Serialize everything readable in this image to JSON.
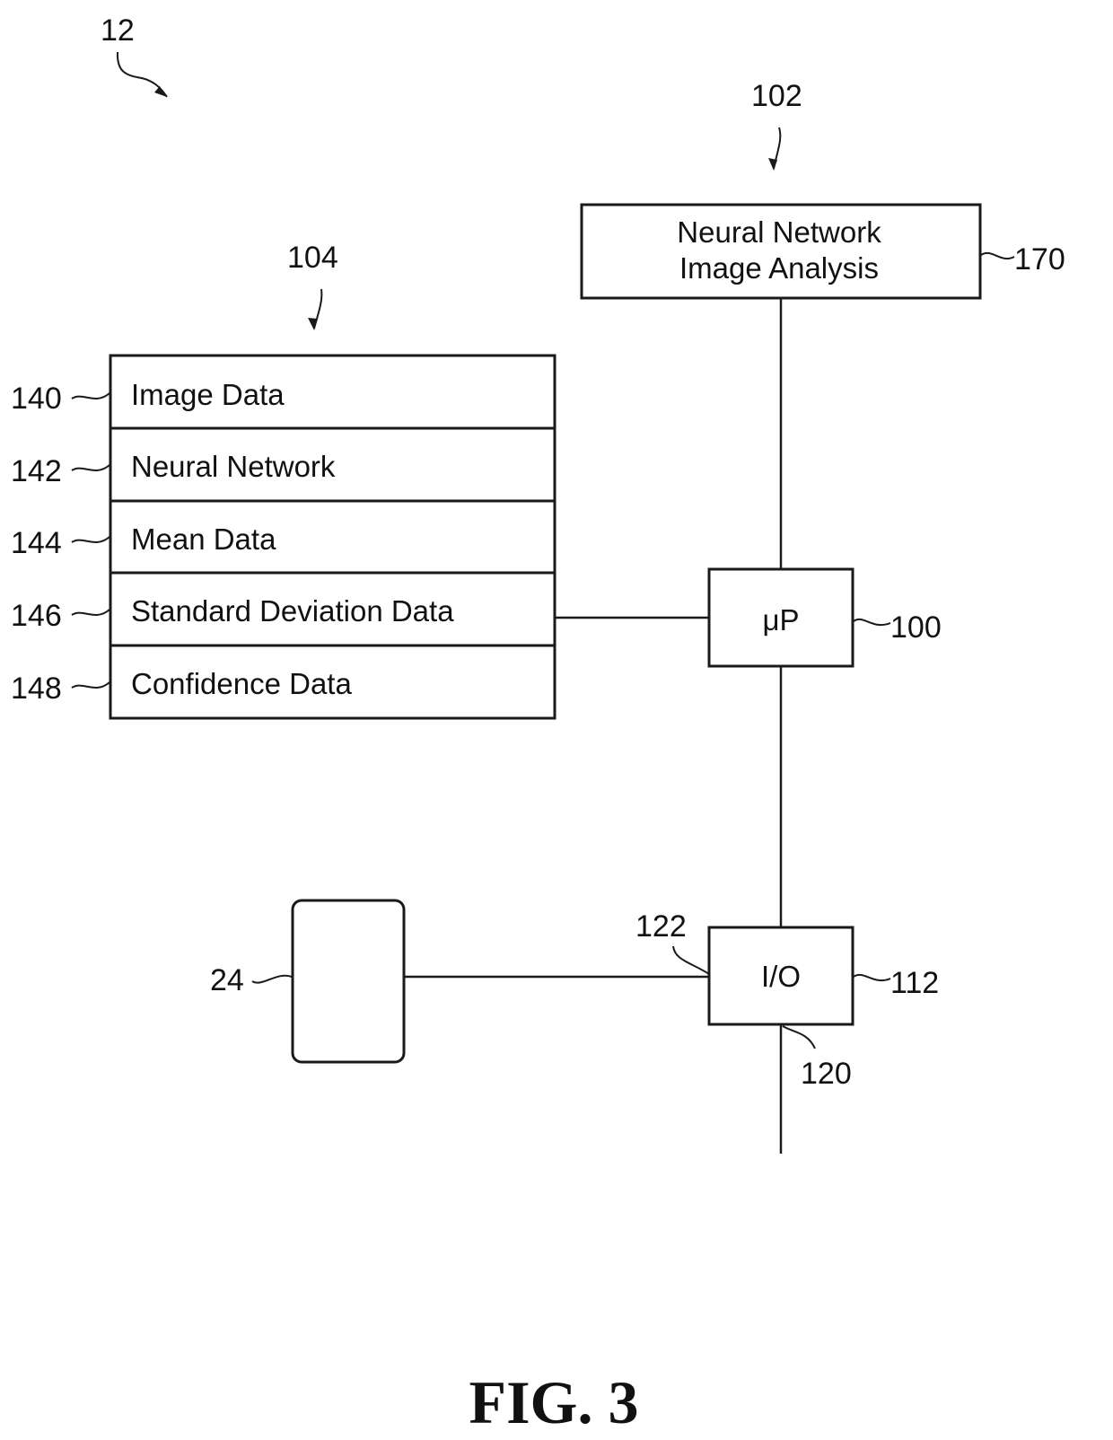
{
  "figure": {
    "caption": "FIG. 3",
    "system_ref": "12"
  },
  "nn_module": {
    "ref": "102",
    "box_ref": "170",
    "title_line1": "Neural Network",
    "title_line2": "Image Analysis"
  },
  "memory": {
    "ref": "104",
    "rows": [
      {
        "ref": "140",
        "label": "Image Data"
      },
      {
        "ref": "142",
        "label": "Neural Network"
      },
      {
        "ref": "144",
        "label": "Mean Data"
      },
      {
        "ref": "146",
        "label": "Standard Deviation Data"
      },
      {
        "ref": "148",
        "label": "Confidence Data"
      }
    ]
  },
  "processor": {
    "ref": "100",
    "label": "μP"
  },
  "io": {
    "ref": "112",
    "label": "I/O",
    "input_ref": "122",
    "bus_ref": "120"
  },
  "device": {
    "ref": "24"
  }
}
